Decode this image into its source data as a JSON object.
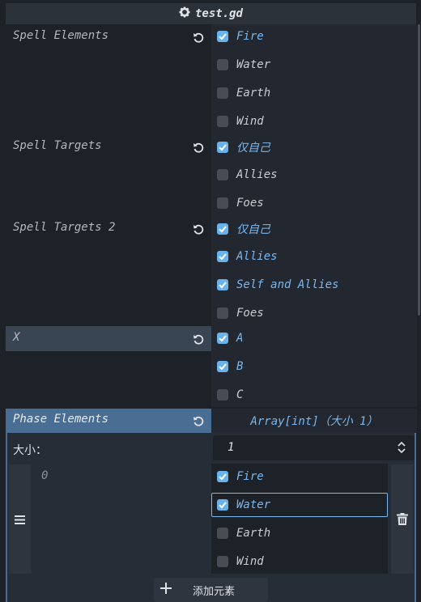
{
  "header": {
    "title": "test.gd",
    "icon": "gear-icon"
  },
  "properties": {
    "spell_elements": {
      "label": "Spell Elements",
      "options": [
        {
          "label": "Fire",
          "checked": true
        },
        {
          "label": "Water",
          "checked": false
        },
        {
          "label": "Earth",
          "checked": false
        },
        {
          "label": "Wind",
          "checked": false
        }
      ]
    },
    "spell_targets": {
      "label": "Spell Targets",
      "options": [
        {
          "label": "仅自己",
          "checked": true
        },
        {
          "label": "Allies",
          "checked": false
        },
        {
          "label": "Foes",
          "checked": false
        }
      ]
    },
    "spell_targets_2": {
      "label": "Spell Targets 2",
      "options": [
        {
          "label": "仅自己",
          "checked": true
        },
        {
          "label": "Allies",
          "checked": true
        },
        {
          "label": "Self and Allies",
          "checked": true
        },
        {
          "label": "Foes",
          "checked": false
        }
      ]
    },
    "x": {
      "label": "X",
      "options": [
        {
          "label": "A",
          "checked": true
        },
        {
          "label": "B",
          "checked": true
        },
        {
          "label": "C",
          "checked": false
        }
      ]
    },
    "phase_elements": {
      "label": "Phase Elements",
      "array_type": "Array[int]（大小 1）",
      "size_label": "大小：",
      "size_value": "1",
      "element_index": "0",
      "options": [
        {
          "label": "Fire",
          "checked": true
        },
        {
          "label": "Water",
          "checked": true
        },
        {
          "label": "Earth",
          "checked": false
        },
        {
          "label": "Wind",
          "checked": false
        }
      ],
      "add_button": "添加元素"
    }
  },
  "colors": {
    "accent": "#6ab2ec",
    "background": "#1d2229",
    "selected_row": "#3a4553",
    "phase_header": "#4a6d94"
  }
}
